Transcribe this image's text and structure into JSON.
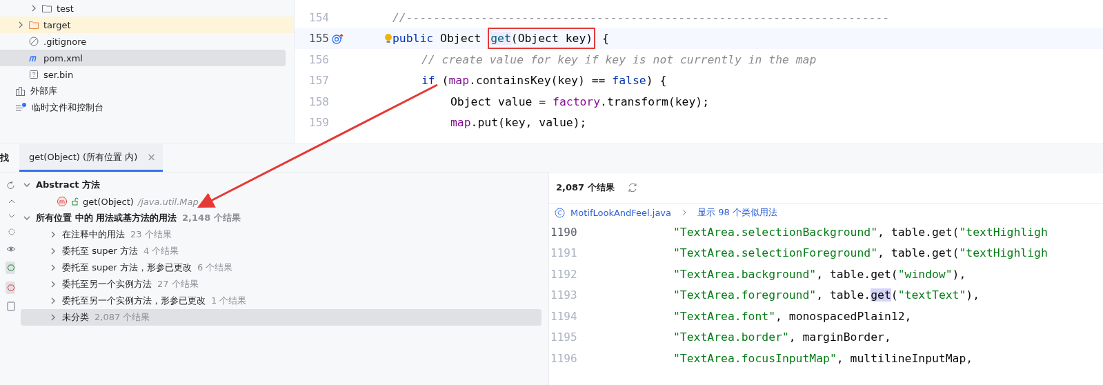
{
  "project_tree": {
    "items": [
      {
        "children": [
          {
            "children": [
              {
                "label": "test",
                "kind": "folder",
                "has_chevron": true,
                "highlighted": false,
                "selected": false
              }
            ]
          },
          {
            "label": "target",
            "kind": "excluded-folder",
            "has_chevron": true,
            "highlighted": true,
            "selected": false
          },
          {
            "label": ".gitignore",
            "kind": "ignore-file",
            "has_chevron": false,
            "highlighted": false,
            "selected": false
          },
          {
            "label": "pom.xml",
            "kind": "maven-file",
            "has_chevron": false,
            "highlighted": false,
            "selected": true
          },
          {
            "label": "ser.bin",
            "kind": "unknown-file",
            "has_chevron": false,
            "highlighted": false,
            "selected": false
          }
        ]
      },
      {
        "label": "外部库",
        "kind": "library",
        "has_chevron": false,
        "highlighted": false,
        "selected": false
      },
      {
        "label": "临时文件和控制台",
        "kind": "scratches",
        "has_chevron": false,
        "highlighted": false,
        "selected": false
      }
    ]
  },
  "editor": {
    "lines": [
      {
        "number": "154",
        "current": false,
        "gutter_icon": false,
        "bulb": false,
        "tokens": [
          {
            "kind": "comment",
            "text": "//-----------------------------------------------------------------------"
          }
        ]
      },
      {
        "number": "155",
        "current": true,
        "gutter_icon": true,
        "bulb": true,
        "tokens": [
          {
            "kind": "keyword",
            "text": "public "
          },
          {
            "kind": "plain",
            "text": "Object "
          },
          {
            "kind": "boxed",
            "tokens": [
              {
                "kind": "method",
                "text": "get"
              },
              {
                "kind": "plain",
                "text": "(Object key)"
              }
            ]
          },
          {
            "kind": "plain",
            "text": " {"
          }
        ],
        "children": [
          {
            "number": "156",
            "current": false,
            "gutter_icon": false,
            "bulb": false,
            "tokens": [
              {
                "kind": "comment",
                "text": "// create value for key if key is not currently in the map"
              }
            ]
          },
          {
            "number": "157",
            "current": false,
            "gutter_icon": false,
            "bulb": false,
            "tokens": [
              {
                "kind": "keyword",
                "text": "if "
              },
              {
                "kind": "plain",
                "text": "("
              },
              {
                "kind": "field",
                "text": "map"
              },
              {
                "kind": "plain",
                "text": ".containsKey(key) == "
              },
              {
                "kind": "keyword",
                "text": "false"
              },
              {
                "kind": "plain",
                "text": ") {"
              }
            ],
            "children": [
              {
                "number": "158",
                "current": false,
                "gutter_icon": false,
                "bulb": false,
                "tokens": [
                  {
                    "kind": "plain",
                    "text": "Object value = "
                  },
                  {
                    "kind": "field",
                    "text": "factory"
                  },
                  {
                    "kind": "plain",
                    "text": ".transform(key);"
                  }
                ]
              },
              {
                "number": "159",
                "current": false,
                "gutter_icon": false,
                "bulb": false,
                "tokens": [
                  {
                    "kind": "field",
                    "text": "map"
                  },
                  {
                    "kind": "plain",
                    "text": ".put(key, value);"
                  }
                ]
              }
            ]
          }
        ]
      }
    ]
  },
  "find_panel": {
    "title": "找",
    "tabs": [
      {
        "label": "get(Object) (所有位置 内)",
        "selected": true,
        "close": "×"
      }
    ],
    "results": [
      {
        "label": "Abstract 方法",
        "expanded": true,
        "selected": false,
        "children": [
          {
            "kind": "method",
            "label": "get(Object)",
            "suffix": "/java.util.Map",
            "selected": false
          }
        ]
      },
      {
        "label": "所有位置 中的 用法或基方法的用法",
        "count": "2,148 个结果",
        "expanded": true,
        "selected": false,
        "children": [
          {
            "kind": "group",
            "label": "在注释中的用法",
            "count": "23 个结果",
            "selected": false
          },
          {
            "kind": "group",
            "label": "委托至 super 方法",
            "count": "4 个结果",
            "selected": false
          },
          {
            "kind": "group",
            "label": "委托至 super 方法，形参已更改",
            "count": "6 个结果",
            "selected": false
          },
          {
            "kind": "group",
            "label": "委托至另一个实例方法",
            "count": "27 个结果",
            "selected": false
          },
          {
            "kind": "group",
            "label": "委托至另一个实例方法，形参已更改",
            "count": "1 个结果",
            "selected": false
          },
          {
            "kind": "group",
            "label": "未分类",
            "count": "2,087 个结果",
            "selected": true
          }
        ]
      }
    ],
    "preview": {
      "count": "2,087 个结果",
      "file": "MotifLookAndFeel.java",
      "similar": "显示 98 个类似用法",
      "lines": [
        {
          "number": "1190",
          "current": true,
          "tokens": [
            {
              "kind": "string",
              "text": "\"TextArea.selectionBackground\""
            },
            {
              "kind": "plain",
              "text": ", table.get("
            },
            {
              "kind": "string",
              "text": "\"textHighligh"
            }
          ]
        },
        {
          "number": "1191",
          "current": false,
          "tokens": [
            {
              "kind": "string",
              "text": "\"TextArea.selectionForeground\""
            },
            {
              "kind": "plain",
              "text": ", table.get("
            },
            {
              "kind": "string",
              "text": "\"textHighligh"
            }
          ]
        },
        {
          "number": "1192",
          "current": false,
          "tokens": [
            {
              "kind": "string",
              "text": "\"TextArea.background\""
            },
            {
              "kind": "plain",
              "text": ", table.get("
            },
            {
              "kind": "string",
              "text": "\"window\""
            },
            {
              "kind": "plain",
              "text": "),"
            }
          ]
        },
        {
          "number": "1193",
          "current": false,
          "tokens": [
            {
              "kind": "string",
              "text": "\"TextArea.foreground\""
            },
            {
              "kind": "plain",
              "text": ", table."
            },
            {
              "kind": "match",
              "text": "get"
            },
            {
              "kind": "plain",
              "text": "("
            },
            {
              "kind": "string",
              "text": "\"textText\""
            },
            {
              "kind": "plain",
              "text": "),"
            }
          ]
        },
        {
          "number": "1194",
          "current": false,
          "tokens": [
            {
              "kind": "string",
              "text": "\"TextArea.font\""
            },
            {
              "kind": "plain",
              "text": ", monospacedPlain12,"
            }
          ]
        },
        {
          "number": "1195",
          "current": false,
          "tokens": [
            {
              "kind": "string",
              "text": "\"TextArea.border\""
            },
            {
              "kind": "plain",
              "text": ", marginBorder,"
            }
          ]
        },
        {
          "number": "1196",
          "current": false,
          "tokens": [
            {
              "kind": "string",
              "text": "\"TextArea.focusInputMap\""
            },
            {
              "kind": "plain",
              "text": ", multilineInputMap,"
            }
          ]
        }
      ]
    }
  }
}
